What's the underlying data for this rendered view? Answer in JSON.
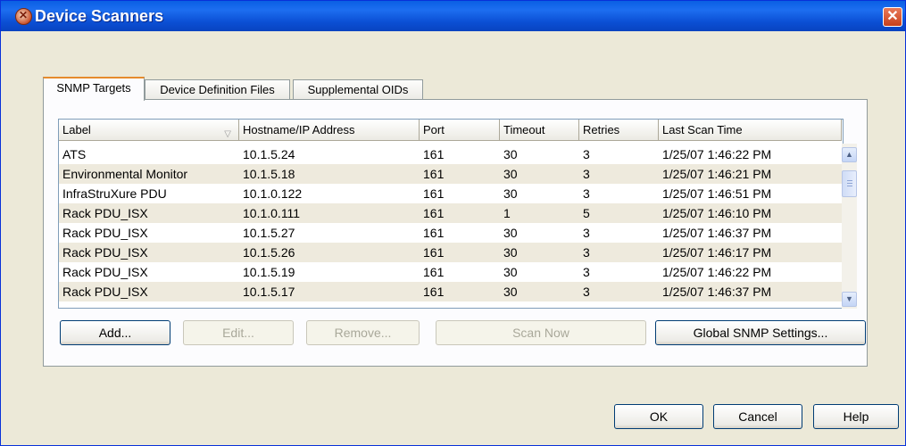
{
  "window": {
    "title": "Device Scanners",
    "close_glyph": "✕"
  },
  "tabs": [
    {
      "label": "SNMP Targets",
      "active": true
    },
    {
      "label": "Device Definition Files",
      "active": false
    },
    {
      "label": "Supplemental OIDs",
      "active": false
    }
  ],
  "table": {
    "headers": [
      "Label",
      "Hostname/IP Address",
      "Port",
      "Timeout",
      "Retries",
      "Last Scan Time"
    ],
    "sort_glyph": "▽",
    "rows": [
      [
        "ATS",
        "10.1.5.24",
        "161",
        "30",
        "3",
        "1/25/07 1:46:22 PM"
      ],
      [
        "Environmental Monitor",
        "10.1.5.18",
        "161",
        "30",
        "3",
        "1/25/07 1:46:21 PM"
      ],
      [
        "InfraStruXure PDU",
        "10.1.0.122",
        "161",
        "30",
        "3",
        "1/25/07 1:46:51 PM"
      ],
      [
        "Rack PDU_ISX",
        "10.1.0.111",
        "161",
        "1",
        "5",
        "1/25/07 1:46:10 PM"
      ],
      [
        "Rack PDU_ISX",
        "10.1.5.27",
        "161",
        "30",
        "3",
        "1/25/07 1:46:37 PM"
      ],
      [
        "Rack PDU_ISX",
        "10.1.5.26",
        "161",
        "30",
        "3",
        "1/25/07 1:46:17 PM"
      ],
      [
        "Rack PDU_ISX",
        "10.1.5.19",
        "161",
        "30",
        "3",
        "1/25/07 1:46:22 PM"
      ],
      [
        "Rack PDU_ISX",
        "10.1.5.17",
        "161",
        "30",
        "3",
        "1/25/07 1:46:37 PM"
      ]
    ]
  },
  "scrollbar": {
    "up_glyph": "▲",
    "down_glyph": "▼"
  },
  "panel_buttons": {
    "add": "Add...",
    "edit": "Edit...",
    "remove": "Remove...",
    "scan_now": "Scan Now",
    "global_snmp": "Global SNMP Settings..."
  },
  "dialog_buttons": {
    "ok": "OK",
    "cancel": "Cancel",
    "help": "Help"
  },
  "colors": {
    "title_bar": "#0a5fe3",
    "dialog_bg": "#ece9d8",
    "alt_row": "#eeeadd",
    "active_tab_accent": "#e68b2c"
  }
}
